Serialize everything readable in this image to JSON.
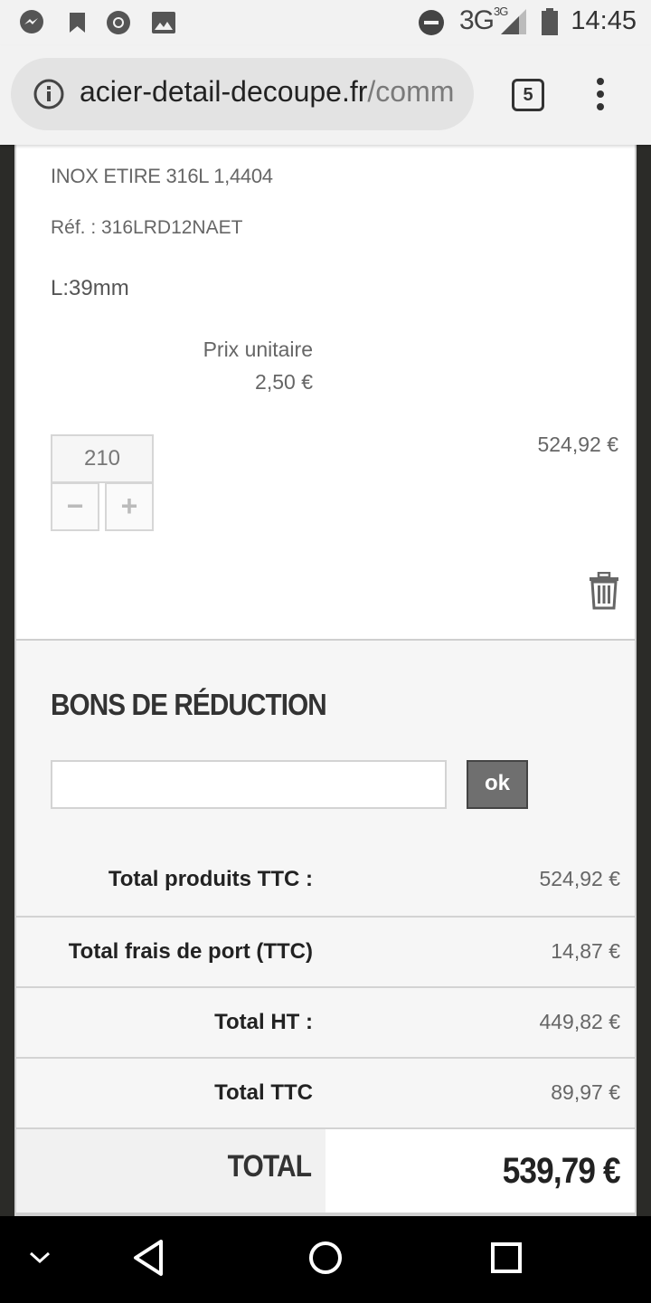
{
  "status_bar": {
    "network": "3G",
    "network_sup": "3G",
    "time": "14:45",
    "icons": [
      "messenger-icon",
      "bookmark-icon",
      "chrome-icon",
      "image-icon",
      "dnd-icon",
      "signal-icon",
      "battery-icon"
    ]
  },
  "browser": {
    "url_domain": "acier-detail-decoupe.fr",
    "url_path": "/comm",
    "tab_count": "5"
  },
  "product": {
    "name": "INOX ETIRE 316L 1,4404",
    "reference": "Réf. : 316LRD12NAET",
    "length": "L:39mm",
    "unit_price_label": "Prix unitaire",
    "unit_price": "2,50 €",
    "quantity": "210",
    "minus_label": "−",
    "plus_label": "+",
    "line_total": "524,92 €"
  },
  "vouchers": {
    "title": "BONS DE RÉDUCTION",
    "input_value": "",
    "ok_label": "ok"
  },
  "totals": [
    {
      "label": "Total produits TTC :",
      "value": "524,92 €"
    },
    {
      "label": "Total frais de port (TTC)",
      "value": "14,87 €"
    },
    {
      "label": "Total HT :",
      "value": "449,82 €"
    },
    {
      "label": "Total TTC",
      "value": "89,97 €"
    }
  ],
  "grand_total": {
    "label": "TOTAL",
    "value": "539,79 €"
  }
}
